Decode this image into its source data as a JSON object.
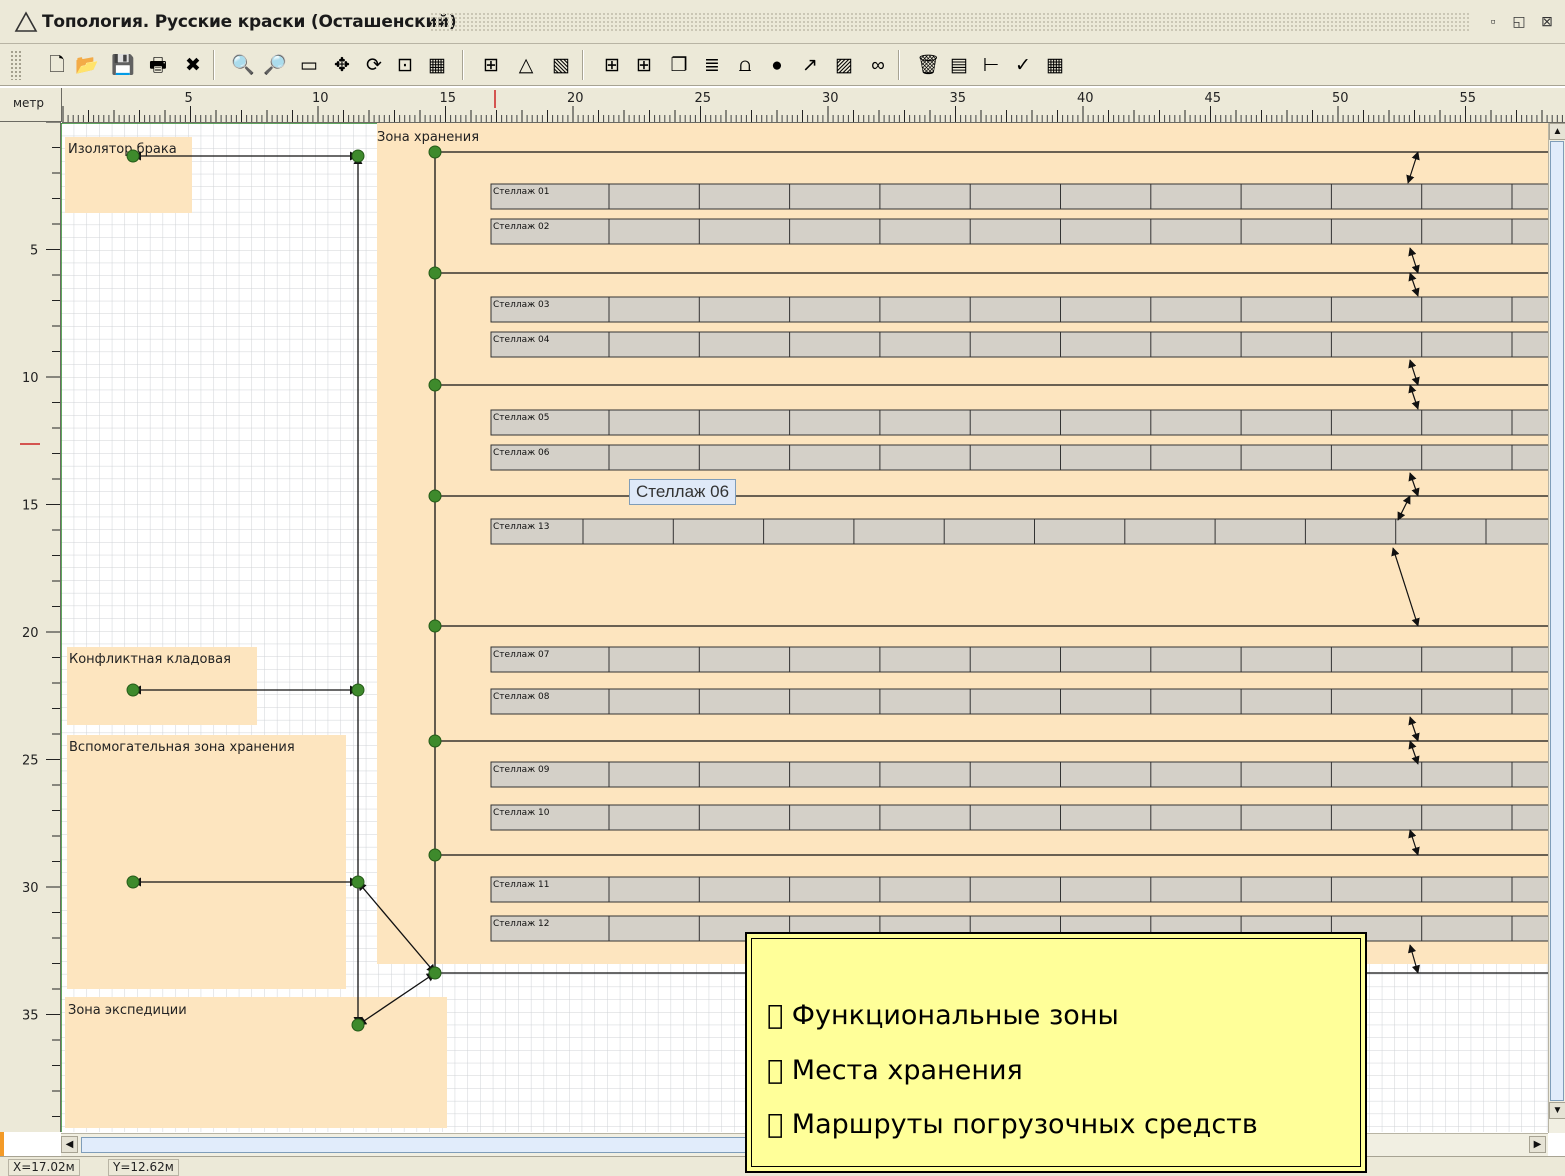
{
  "window": {
    "title": "Топология. Русские краски (Осташенский)"
  },
  "toolbar": {
    "buttons": [
      {
        "name": "new-icon",
        "glyph": "🗋"
      },
      {
        "name": "open-icon",
        "glyph": "📂"
      },
      {
        "name": "save-icon",
        "glyph": "💾"
      },
      {
        "name": "print-icon",
        "glyph": "🖶"
      },
      {
        "name": "close-icon",
        "glyph": "✖"
      },
      {
        "name": "zoom-in-icon",
        "glyph": "🔍"
      },
      {
        "name": "zoom-out-icon",
        "glyph": "🔎"
      },
      {
        "name": "ruler-icon",
        "glyph": "▭"
      },
      {
        "name": "move-icon",
        "glyph": "✥"
      },
      {
        "name": "rotate-icon",
        "glyph": "⟳"
      },
      {
        "name": "select-area-icon",
        "glyph": "⊡"
      },
      {
        "name": "keyboard-icon",
        "glyph": "▦"
      },
      {
        "name": "rack-tool-icon",
        "glyph": "⊞"
      },
      {
        "name": "triangle-icon",
        "glyph": "△"
      },
      {
        "name": "hatch-icon",
        "glyph": "▧"
      },
      {
        "name": "add-rack-icon",
        "glyph": "⊞"
      },
      {
        "name": "add-racks-icon",
        "glyph": "⊞"
      },
      {
        "name": "group-icon",
        "glyph": "❐"
      },
      {
        "name": "layers-icon",
        "glyph": "≣"
      },
      {
        "name": "route-icon",
        "glyph": "⩍"
      },
      {
        "name": "add-node-icon",
        "glyph": "●"
      },
      {
        "name": "connect-icon",
        "glyph": "↗"
      },
      {
        "name": "zone-icon",
        "glyph": "▨"
      },
      {
        "name": "link-icon",
        "glyph": "∞"
      },
      {
        "name": "delete-icon",
        "glyph": "🗑"
      },
      {
        "name": "properties-icon",
        "glyph": "▤"
      },
      {
        "name": "tree-icon",
        "glyph": "⊢"
      },
      {
        "name": "check-icon",
        "glyph": "✓"
      },
      {
        "name": "grid-icon",
        "glyph": "▦"
      }
    ]
  },
  "ruler": {
    "unit": "метр",
    "h_labels": [
      "5",
      "10",
      "15",
      "20",
      "25",
      "30",
      "35",
      "40",
      "45",
      "50",
      "55"
    ],
    "v_labels": [
      "5",
      "10",
      "15",
      "20",
      "25",
      "30",
      "35"
    ]
  },
  "zones": {
    "defect": "Изолятор брака",
    "storage": "Зона хранения",
    "conflict": "Конфликтная кладовая",
    "aux": "Вспомогательная зона хранения",
    "expedition": "Зона экспедиции"
  },
  "racks": [
    "Стеллаж 01",
    "Стеллаж 02",
    "Стеллаж 03",
    "Стеллаж 04",
    "Стеллаж 05",
    "Стеллаж 06",
    "Стеллаж 13",
    "Стеллаж 07",
    "Стеллаж 08",
    "Стеллаж 09",
    "Стеллаж 10",
    "Стеллаж 11",
    "Стеллаж 12"
  ],
  "tooltip": "Стеллаж 06",
  "status": {
    "x": "X=17.02м",
    "y": "Y=12.62м"
  },
  "legend": {
    "items": [
      "\u0000 Функциональные зоны",
      "\u0000  Места хранения",
      "\u0000 Маршруты погрузочных средств"
    ]
  },
  "colors": {
    "zone_fill": "#fde5bf",
    "rack_fill": "#d4d0c8",
    "node": "#3e8a2c",
    "legend_bg": "#ffff99"
  }
}
